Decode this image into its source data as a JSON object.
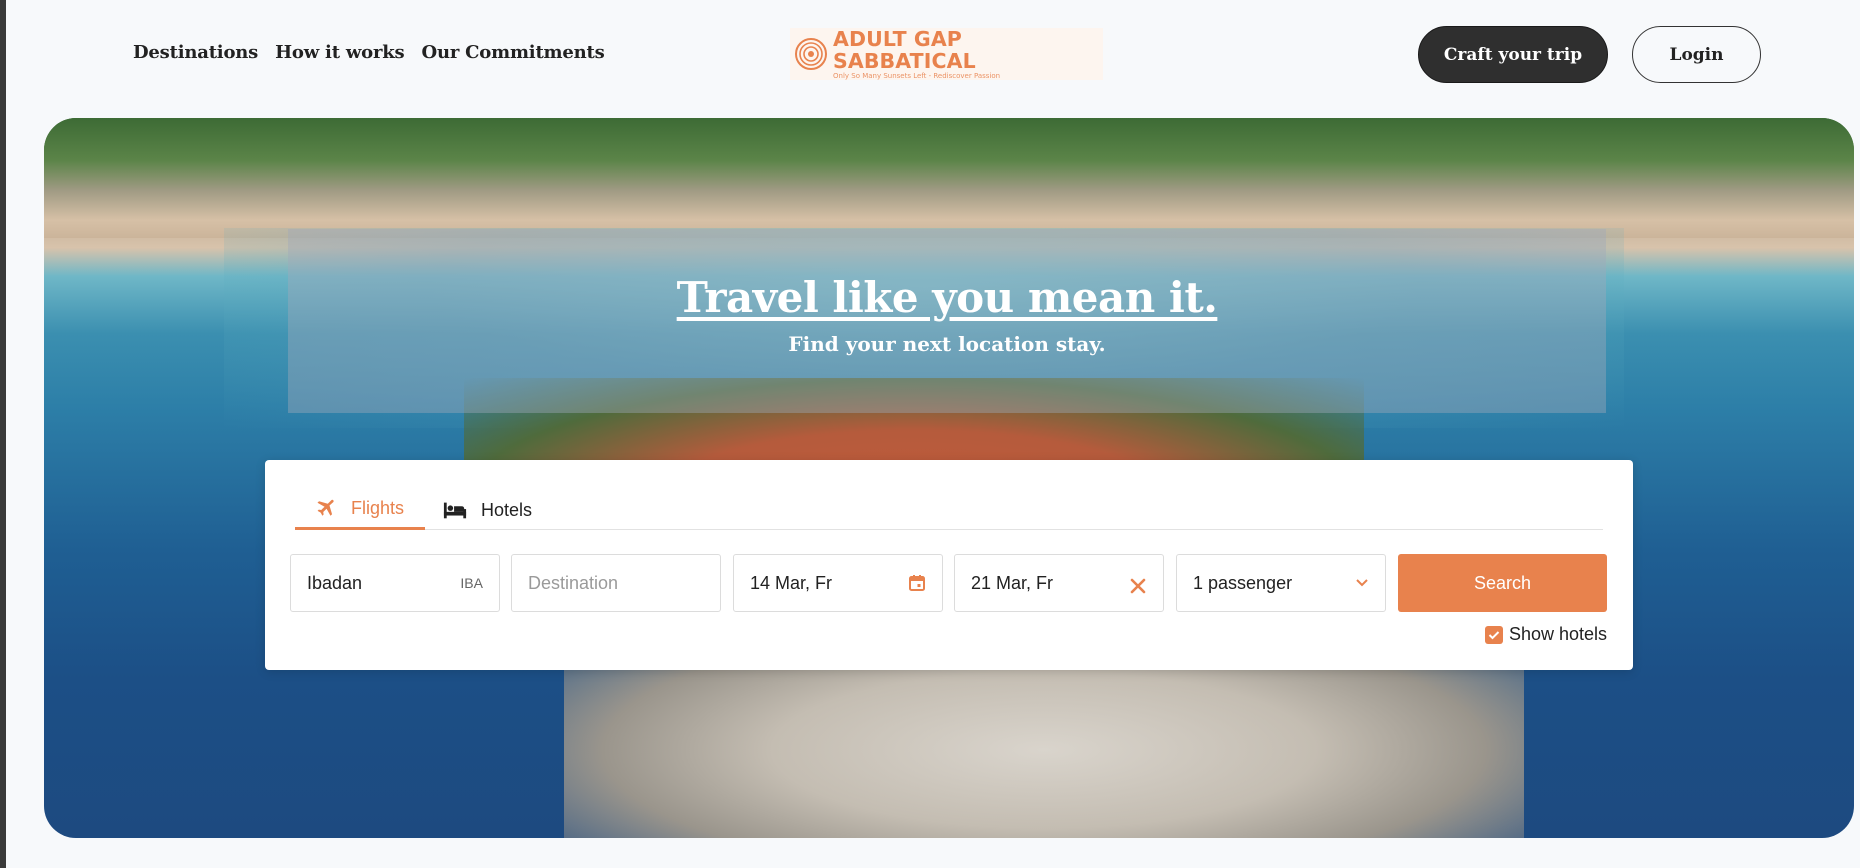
{
  "nav": {
    "items": [
      "Destinations",
      "How it works",
      "Our Commitments"
    ]
  },
  "brand": {
    "name": "ADULT GAP SABBATICAL",
    "tagline": "Only So Many Sunsets Left - Rediscover Passion",
    "accent": "#e8824d"
  },
  "header": {
    "craft_label": "Craft your trip",
    "login_label": "Login"
  },
  "hero": {
    "headline": "Travel like you mean it.",
    "subheadline": "Find your next location stay."
  },
  "search": {
    "tabs": [
      {
        "label": "Flights",
        "icon": "airplane-icon",
        "active": true
      },
      {
        "label": "Hotels",
        "icon": "bed-icon",
        "active": false
      }
    ],
    "origin": {
      "value": "Ibadan",
      "code": "IBA"
    },
    "destination": {
      "placeholder": "Destination"
    },
    "depart_date": {
      "value": "14 Mar, Fr",
      "icon": "calendar-icon"
    },
    "return_date": {
      "value": "21 Mar, Fr",
      "icon": "close-icon"
    },
    "passengers": {
      "value": "1 passenger",
      "icon": "chevron-down-icon"
    },
    "search_label": "Search",
    "show_hotels": {
      "label": "Show hotels",
      "checked": true
    }
  }
}
